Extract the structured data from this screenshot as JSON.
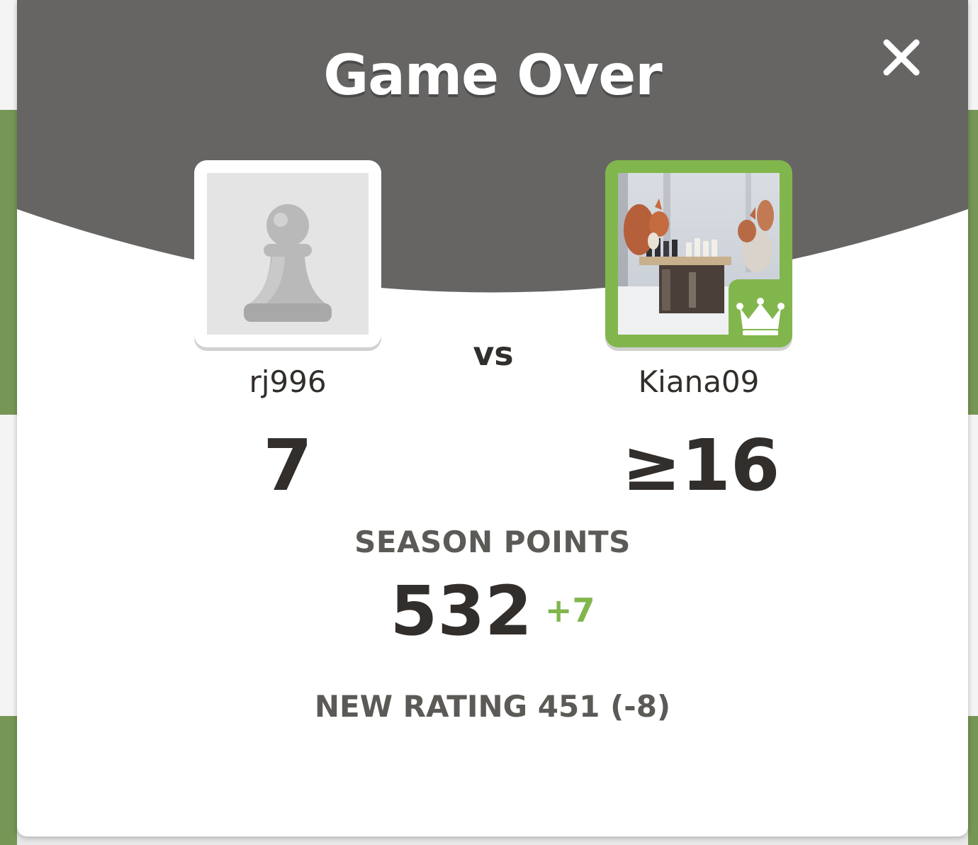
{
  "modal": {
    "title": "Game Over",
    "close_icon": "close-icon"
  },
  "players": {
    "left": {
      "name": "rj996",
      "score": "7",
      "avatar_icon": "pawn-icon"
    },
    "vs_label": "vs",
    "right": {
      "name": "Kiana09",
      "score": "≥16",
      "avatar": "squirrels-chess-photo",
      "badge_icon": "crown-icon"
    }
  },
  "season": {
    "label": "SEASON POINTS",
    "value": "532",
    "delta": "+7"
  },
  "rating": {
    "text": "NEW RATING 451 (-8)"
  },
  "colors": {
    "header": "#666564",
    "accent_green": "#81b64c",
    "text_dark": "#312e2b",
    "text_muted": "#5c5a57"
  }
}
